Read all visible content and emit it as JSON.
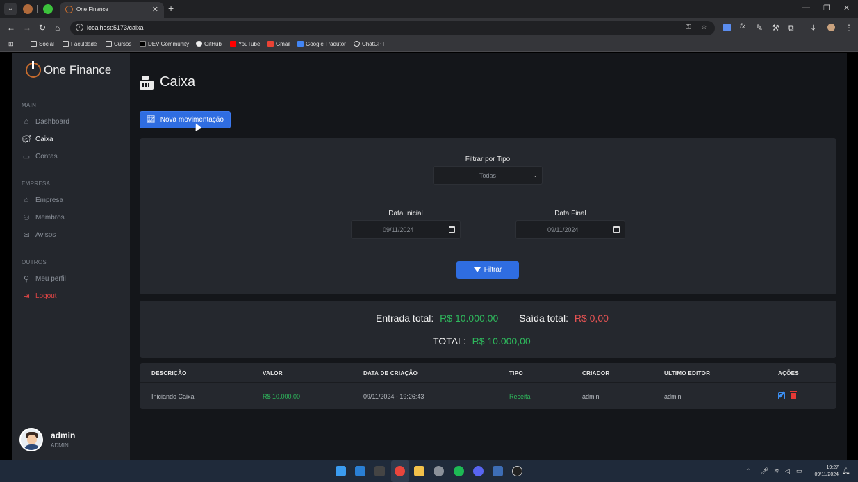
{
  "browser": {
    "tab_title": "One Finance",
    "url": "localhost:5173/caixa",
    "bookmarks": [
      "Social",
      "Faculdade",
      "Cursos",
      "DEV Community",
      "GitHub",
      "YouTube",
      "Gmail",
      "Google Tradutor",
      "ChatGPT"
    ]
  },
  "sidebar": {
    "brand": "One Finance",
    "sections": {
      "main": "MAIN",
      "empresa": "EMPRESA",
      "outros": "OUTROS"
    },
    "items": {
      "dashboard": "Dashboard",
      "caixa": "Caixa",
      "contas": "Contas",
      "empresa": "Empresa",
      "membros": "Membros",
      "avisos": "Avisos",
      "perfil": "Meu perfil",
      "logout": "Logout"
    },
    "user": {
      "name": "admin",
      "role": "ADMIN"
    }
  },
  "main": {
    "title": "Caixa",
    "new_button": "Nova movimentação",
    "filter": {
      "type_label": "Filtrar por Tipo",
      "type_value": "Todas",
      "start_label": "Data Inicial",
      "start_value": "09/11/2024",
      "end_label": "Data Final",
      "end_value": "09/11/2024",
      "button": "Filtrar"
    },
    "totals": {
      "in_label": "Entrada total:",
      "in_value": "R$ 10.000,00",
      "out_label": "Saída total:",
      "out_value": "R$ 0,00",
      "total_label": "TOTAL:",
      "total_value": "R$ 10.000,00"
    },
    "table": {
      "headers": [
        "DESCRIÇÃO",
        "VALOR",
        "DATA DE CRIAÇÃO",
        "TIPO",
        "CRIADOR",
        "ULTIMO EDITOR",
        "AÇÕES"
      ],
      "rows": [
        {
          "descricao": "Iniciando Caixa",
          "valor": "R$ 10.000,00",
          "data": "09/11/2024 - 19:26:43",
          "tipo": "Receita",
          "criador": "admin",
          "editor": "admin"
        }
      ]
    }
  },
  "taskbar": {
    "time": "19:27",
    "date": "09/11/2024"
  },
  "colors": {
    "accent": "#2f6de1",
    "positive": "#2eb85c",
    "negative": "#e55353",
    "logout": "#e04545"
  }
}
